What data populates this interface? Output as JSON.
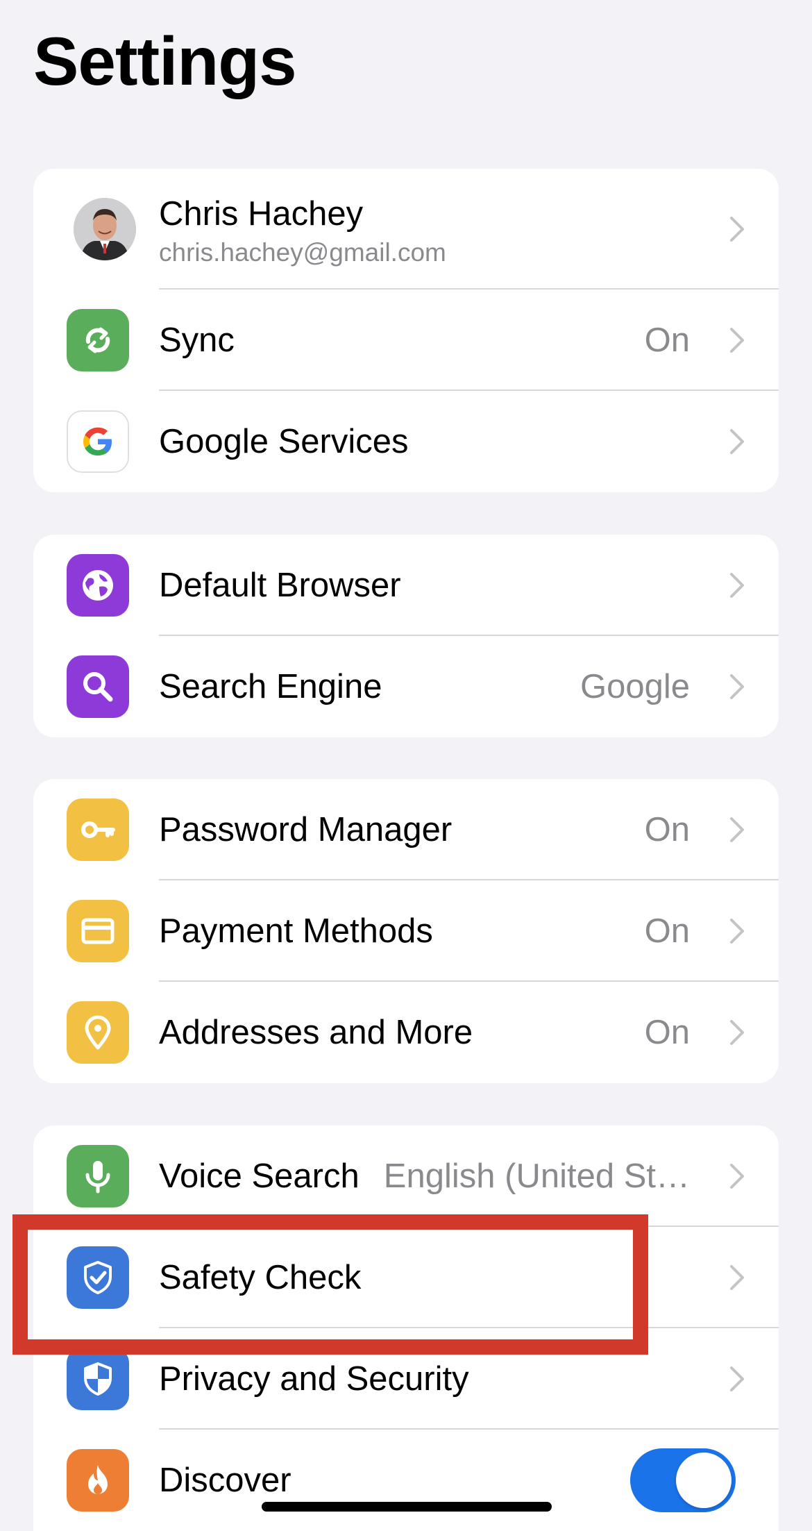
{
  "page": {
    "title": "Settings"
  },
  "colors": {
    "background": "#f2f2f7",
    "card": "#ffffff",
    "secondary_text": "#8a8a8e",
    "sync_green": "#5aad5b",
    "purple": "#8e3ad9",
    "yellow": "#f2c043",
    "blue": "#3c78d8",
    "orange": "#ed7e34",
    "toggle_on": "#1a73e8",
    "highlight_red": "#d13a2a"
  },
  "account": {
    "name": "Chris Hachey",
    "email": "chris.hachey@gmail.com"
  },
  "group1": {
    "sync": {
      "label": "Sync",
      "value": "On",
      "icon": "sync-icon"
    },
    "google_services": {
      "label": "Google Services",
      "icon": "google-logo-icon"
    }
  },
  "group2": {
    "default_browser": {
      "label": "Default Browser",
      "icon": "globe-icon"
    },
    "search_engine": {
      "label": "Search Engine",
      "value": "Google",
      "icon": "search-icon"
    }
  },
  "group3": {
    "password_manager": {
      "label": "Password Manager",
      "value": "On",
      "icon": "key-icon"
    },
    "payment_methods": {
      "label": "Payment Methods",
      "value": "On",
      "icon": "credit-card-icon"
    },
    "addresses": {
      "label": "Addresses and More",
      "value": "On",
      "icon": "location-pin-icon"
    }
  },
  "group4": {
    "voice_search": {
      "label": "Voice Search",
      "value": "English (United St…",
      "icon": "microphone-icon"
    },
    "safety_check": {
      "label": "Safety Check",
      "icon": "shield-check-icon"
    },
    "privacy_security": {
      "label": "Privacy and Security",
      "icon": "shield-icon"
    },
    "discover": {
      "label": "Discover",
      "toggle_on": true,
      "icon": "flame-icon"
    }
  }
}
